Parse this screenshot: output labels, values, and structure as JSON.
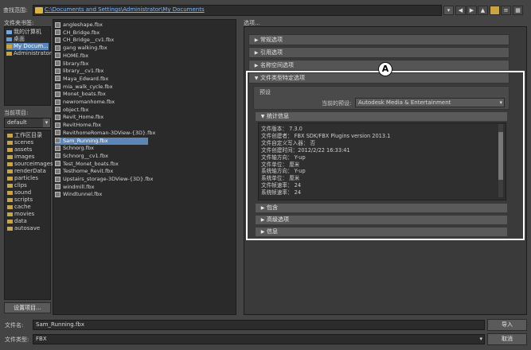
{
  "top": {
    "lookin_label": "查找范围:",
    "path": "C:\\Documents and Settings\\Administrator\\My Documents"
  },
  "bookmarks": {
    "label": "文件夹书签:",
    "items": [
      "我的计算机",
      "桌面",
      "My Docum...",
      "Administrator"
    ]
  },
  "project": {
    "label": "当前项目:",
    "select_value": "default",
    "items": [
      "工作区目录",
      "scenes",
      "assets",
      "images",
      "sourceimages",
      "renderData",
      "particles",
      "clips",
      "sound",
      "scripts",
      "cache",
      "movies",
      "data",
      "autosave"
    ],
    "set_button": "设置项目..."
  },
  "files": [
    "angleshape.fbx",
    "CH_Bridge.fbx",
    "CH_Bridge__cv1.fbx",
    "gang walking.fbx",
    "HOME.fbx",
    "library.fbx",
    "library__cv1.fbx",
    "Maya_Edward.fbx",
    "mia_walk_cycle.fbx",
    "Monet_boats.fbx",
    "newromanhome.fbx",
    "object.fbx",
    "Revit_Home.fbx",
    "RevitHome.fbx",
    "RevithomeRoman-3DView-{3D}.fbx",
    "Sam_Running.fbx",
    "Schnorg.fbx",
    "Schnorg__cv1.fbx",
    "Test_Monet_boats.fbx",
    "Testhome_Revit.fbx",
    "Upstairs_storage-3DView-{3D}.fbx",
    "windmill.fbx",
    "Windtunnel.fbx"
  ],
  "selected_file": "Sam_Running.fbx",
  "options": {
    "label": "选项...",
    "sections": [
      "常规选项",
      "引用选项",
      "名称空间选项",
      "文件类型特定选项"
    ],
    "preset_label": "预设",
    "current_preset_label": "当前的预设:",
    "current_preset_value": "Autodesk Media & Entertainment",
    "stats_label": "统计信息",
    "stats": [
      "文件版本： 7.3.0",
      "文件创建者： FBX SDK/FBX Plugins version 2013.1",
      "文件自定义写入器： 否",
      "文件创建时间：2012/2/22  16:33:41",
      "文件轴方向： Y-up",
      "文件单位： 厘米",
      "系统轴方向： Y-up",
      "系统单位： 厘米",
      "文件帧速率： 24",
      "系统帧速率： 24"
    ],
    "sub_sections": [
      "包含",
      "高级选项",
      "信息"
    ]
  },
  "callout": "A",
  "bottom": {
    "filename_label": "文件名:",
    "filename_value": "Sam_Running.fbx",
    "filetype_label": "文件类型:",
    "filetype_value": "FBX",
    "import_button": "导入",
    "cancel_button": "取消"
  },
  "colors": {
    "highlight": "#5c86b8",
    "callout_border": "#ffffff"
  }
}
